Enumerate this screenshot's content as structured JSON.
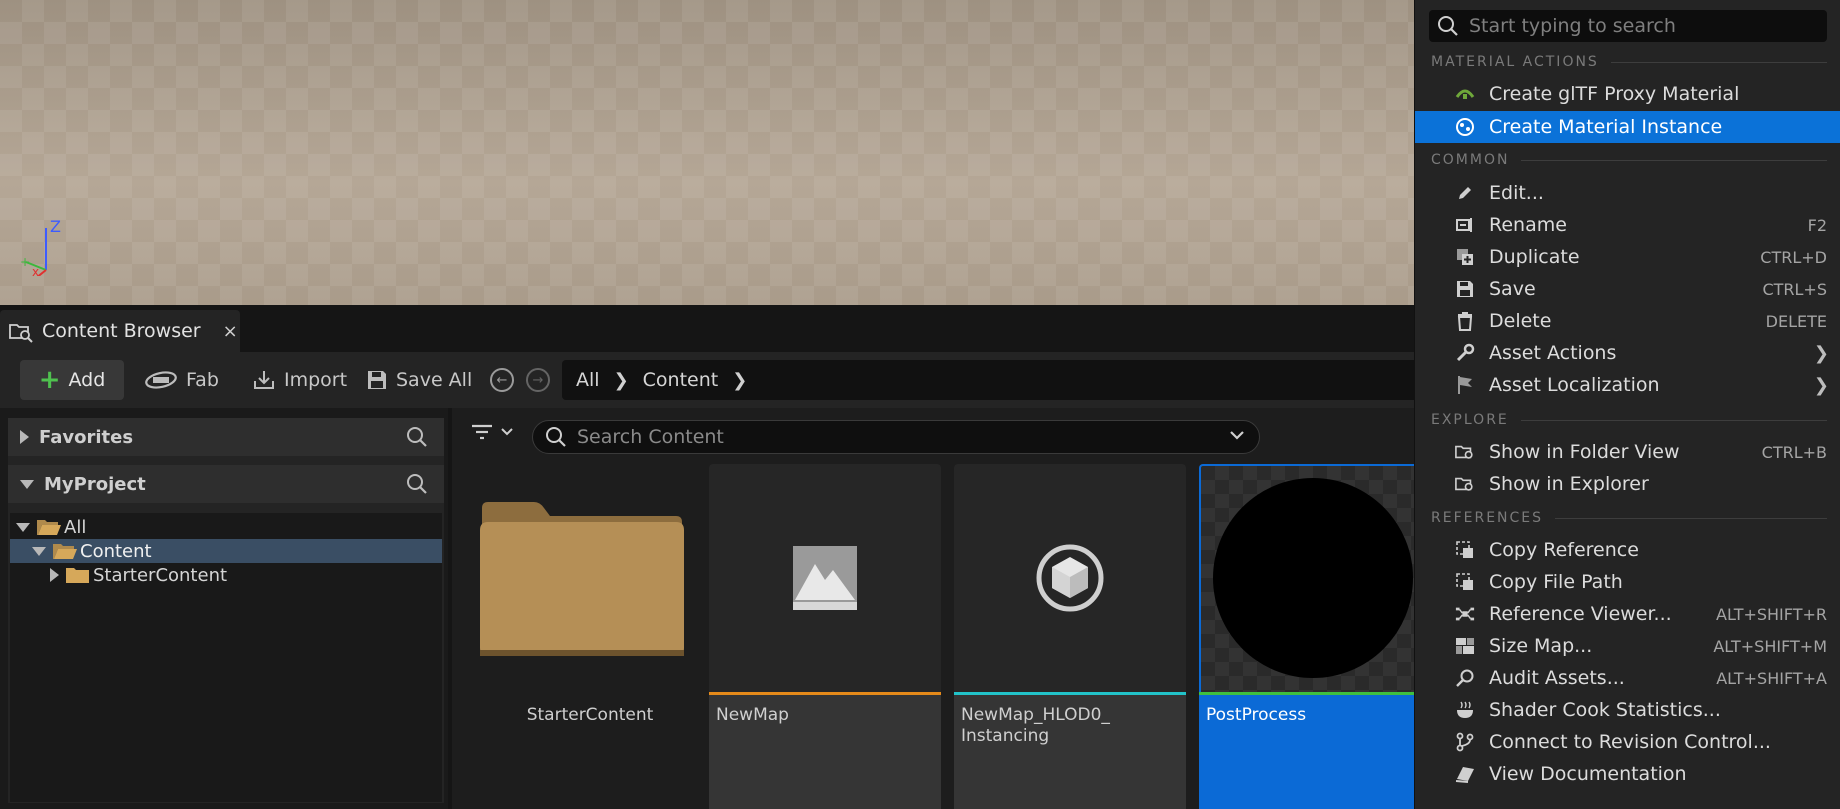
{
  "tab": {
    "title": "Content Browser",
    "close": "×"
  },
  "toolbar": {
    "add": "Add",
    "fab": "Fab",
    "import": "Import",
    "save_all": "Save All"
  },
  "breadcrumb": [
    "All",
    "Content"
  ],
  "left_panel": {
    "favorites": "Favorites",
    "project": "MyProject",
    "tree": [
      {
        "label": "All"
      },
      {
        "label": "Content"
      },
      {
        "label": "StarterContent"
      }
    ]
  },
  "grid": {
    "search_placeholder": "Search Content",
    "tiles": [
      {
        "label": "StarterContent"
      },
      {
        "label": "NewMap"
      },
      {
        "label": "NewMap_HLOD0_",
        "label2": "Instancing"
      },
      {
        "label": "PostProcess"
      }
    ]
  },
  "menu": {
    "search_placeholder": "Start typing to search",
    "sections": {
      "material_actions": "MATERIAL ACTIONS",
      "common": "COMMON",
      "explore": "EXPLORE",
      "references": "REFERENCES"
    },
    "items": {
      "gltf": "Create glTF Proxy Material",
      "mat_instance": "Create Material Instance",
      "edit": "Edit...",
      "rename": "Rename",
      "rename_sc": "F2",
      "duplicate": "Duplicate",
      "duplicate_sc": "CTRL+D",
      "save": "Save",
      "save_sc": "CTRL+S",
      "delete": "Delete",
      "delete_sc": "DELETE",
      "asset_actions": "Asset Actions",
      "asset_localization": "Asset Localization",
      "show_folder": "Show in Folder View",
      "show_folder_sc": "CTRL+B",
      "show_explorer": "Show in Explorer",
      "copy_ref": "Copy Reference",
      "copy_path": "Copy File Path",
      "ref_viewer": "Reference Viewer...",
      "ref_viewer_sc": "ALT+SHIFT+R",
      "size_map": "Size Map...",
      "size_map_sc": "ALT+SHIFT+M",
      "audit": "Audit Assets...",
      "audit_sc": "ALT+SHIFT+A",
      "shader_stats": "Shader Cook Statistics...",
      "revision": "Connect to Revision Control...",
      "docs": "View Documentation"
    }
  },
  "viewport": {
    "axis_z": "Z"
  }
}
